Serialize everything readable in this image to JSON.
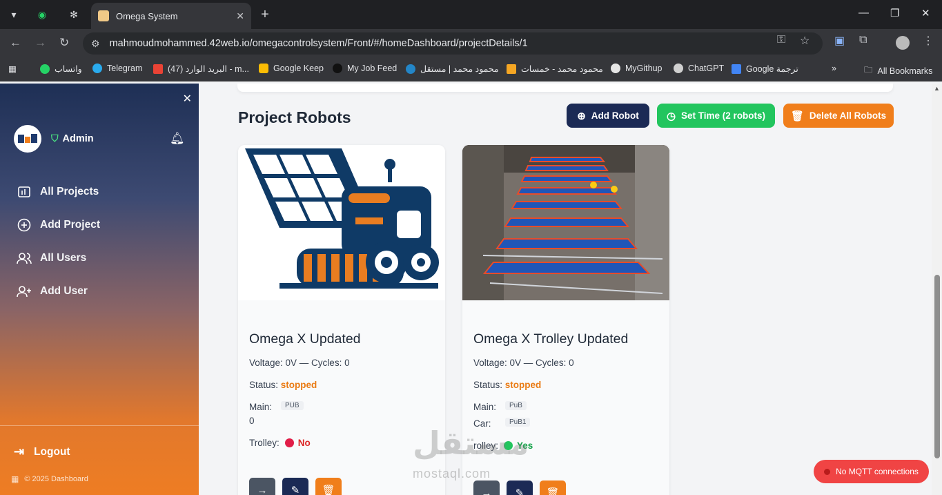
{
  "browser": {
    "tab_title": "Omega System",
    "url": "mahmoudmohammed.42web.io/omegacontrolsystem/Front/#/homeDashboard/projectDetails/1",
    "bookmarks": [
      "واتساب",
      "Telegram",
      "البريد الوارد (47) - m...",
      "Google Keep",
      "My Job Feed",
      "محمود محمد | مستقل",
      "محمود محمد - خمسات",
      "MyGithup",
      "ChatGPT",
      "Google ترجمة"
    ],
    "all_bookmarks": "All Bookmarks"
  },
  "sidebar": {
    "admin_label": "Admin",
    "items": [
      "All Projects",
      "Add Project",
      "All Users",
      "Add User"
    ],
    "logout": "Logout",
    "footer": "© 2025 Dashboard"
  },
  "main": {
    "title": "Project Robots",
    "add_robot": "Add Robot",
    "set_time": "Set Time (2 robots)",
    "delete_all": "Delete All Robots"
  },
  "robots": [
    {
      "name": "Omega X Updated",
      "voltage_line": "Voltage: 0V — Cycles: 0",
      "status_label": "Status:",
      "status": "stopped",
      "main_label": "Main:",
      "main_chip": "PUB",
      "main_value": "0",
      "trolley_label": "Trolley:",
      "trolley": "No"
    },
    {
      "name": "Omega X Trolley Updated",
      "voltage_line": "Voltage: 0V — Cycles: 0",
      "status_label": "Status:",
      "status": "stopped",
      "main_label": "Main:",
      "main_chip": "PuB",
      "car_label": "Car:",
      "car_chip": "PuB1",
      "trolley_label": "rolley:",
      "trolley": "Yes"
    }
  ],
  "mqtt_status": "No MQTT connections",
  "watermark": {
    "text": "مستقل",
    "url": "mostaql.com"
  },
  "colors": {
    "navy": "#1b2a55",
    "green": "#22c55e",
    "orange": "#f07e1b",
    "red": "#f04444"
  }
}
